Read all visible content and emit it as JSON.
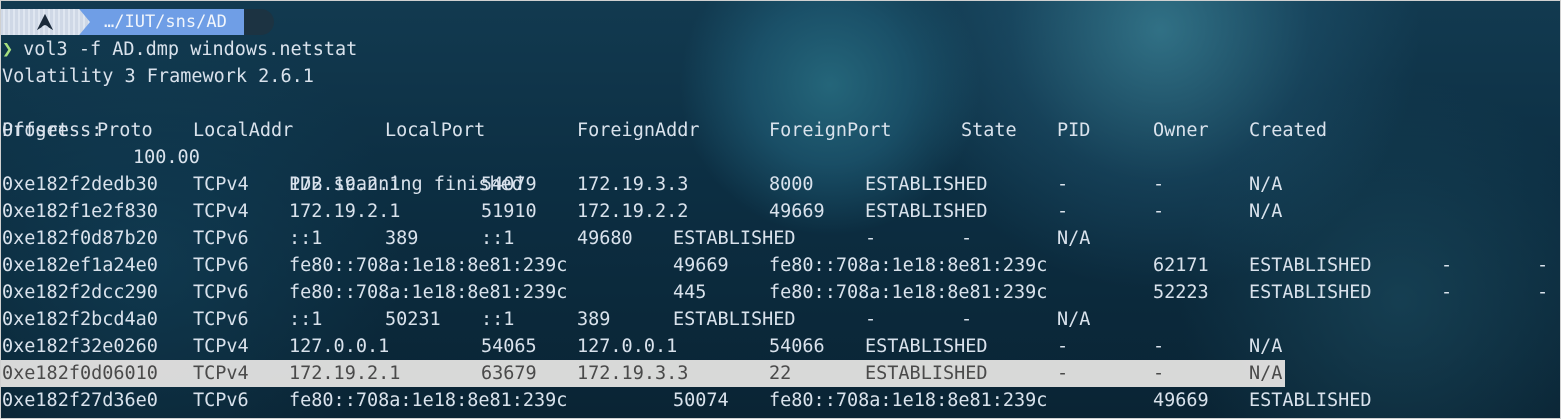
{
  "prompt": {
    "path": "…/IUT/sns/AD",
    "os_icon": "arch-linux-icon"
  },
  "command": "vol3 -f AD.dmp windows.netstat",
  "framework_line": "Volatility 3 Framework 2.6.1",
  "progress": {
    "label": "Progress:",
    "value": "100.00",
    "message": "PDB scanning finished"
  },
  "headers": [
    "Offset",
    "Proto",
    "LocalAddr",
    "LocalPort",
    "ForeignAddr",
    "ForeignPort",
    "State",
    "PID",
    "Owner",
    "Created"
  ],
  "rows": [
    {
      "cols": [
        "0xe182f2dedb30",
        "TCPv4",
        "172.19.2.1",
        "54079",
        "172.19.3.3",
        "8000",
        "ESTABLISHED",
        "-",
        "-",
        "N/A"
      ],
      "shift": false
    },
    {
      "cols": [
        "0xe182f1e2f830",
        "TCPv4",
        "172.19.2.1",
        "51910",
        "172.19.2.2",
        "49669",
        "ESTABLISHED",
        "-",
        "-",
        "N/A"
      ],
      "shift": false
    },
    {
      "cols": [
        "0xe182f0d87b20",
        "TCPv6",
        "::1",
        "389",
        "::1",
        "49680",
        "ESTABLISHED",
        "-",
        "-",
        "N/A"
      ],
      "shift": "short"
    },
    {
      "cols": [
        "0xe182ef1a24e0",
        "TCPv6",
        "fe80::708a:1e18:8e81:239c",
        "49669",
        "fe80::708a:1e18:8e81:239c",
        "62171",
        "ESTABLISHED",
        "-",
        "-"
      ],
      "shift": "long"
    },
    {
      "cols": [
        "0xe182f2dcc290",
        "TCPv6",
        "fe80::708a:1e18:8e81:239c",
        "445",
        "fe80::708a:1e18:8e81:239c",
        "52223",
        "ESTABLISHED",
        "-",
        "-"
      ],
      "shift": "long"
    },
    {
      "cols": [
        "0xe182f2bcd4a0",
        "TCPv6",
        "::1",
        "50231",
        "::1",
        "389",
        "ESTABLISHED",
        "-",
        "-",
        "N/A"
      ],
      "shift": "short"
    },
    {
      "cols": [
        "0xe182f32e0260",
        "TCPv4",
        "127.0.0.1",
        "54065",
        "127.0.0.1",
        "54066",
        "ESTABLISHED",
        "-",
        "-",
        "N/A"
      ],
      "shift": false
    },
    {
      "cols": [
        "0xe182f0d06010",
        "TCPv4",
        "172.19.2.1",
        "63679",
        "172.19.3.3",
        "22",
        "ESTABLISHED",
        "-",
        "-",
        "N/A"
      ],
      "shift": false,
      "selected": true
    },
    {
      "cols": [
        "0xe182f27d36e0",
        "TCPv6",
        "fe80::708a:1e18:8e81:239c",
        "50074",
        "fe80::708a:1e18:8e81:239c",
        "49669",
        "ESTABLISHED"
      ],
      "shift": "long"
    }
  ]
}
